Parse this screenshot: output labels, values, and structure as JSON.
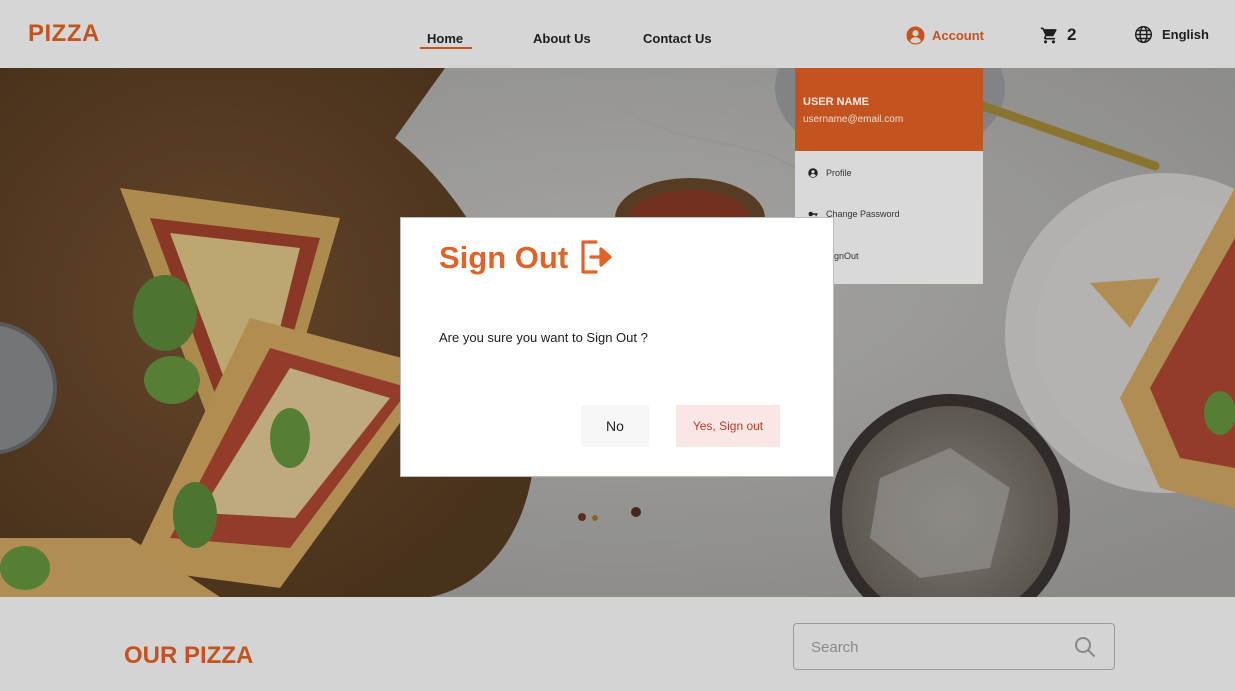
{
  "header": {
    "logo": "PIZZA",
    "nav": [
      {
        "label": "Home",
        "active": true
      },
      {
        "label": "About Us"
      },
      {
        "label": "Contact Us"
      }
    ],
    "account_label": "Account",
    "cart_count": "2",
    "language": "English"
  },
  "account_menu": {
    "user_name": "USER NAME",
    "email": "username@email.com",
    "items": [
      {
        "label": "Profile",
        "icon": "user-circle-icon"
      },
      {
        "label": "Change Password",
        "icon": "key-icon"
      },
      {
        "label": "SignOut",
        "icon": "logout-icon"
      }
    ]
  },
  "dialog": {
    "title": "Sign Out",
    "message": "Are you sure you want to Sign Out ?",
    "no_label": "No",
    "yes_label": "Yes, Sign out"
  },
  "section": {
    "title": "OUR PIZZA"
  },
  "search": {
    "placeholder": "Search"
  },
  "colors": {
    "accent": "#c4541f",
    "dialog_title": "#e0632a",
    "yes_button_bg": "#fbe6e6",
    "yes_button_text": "#c0392b"
  }
}
